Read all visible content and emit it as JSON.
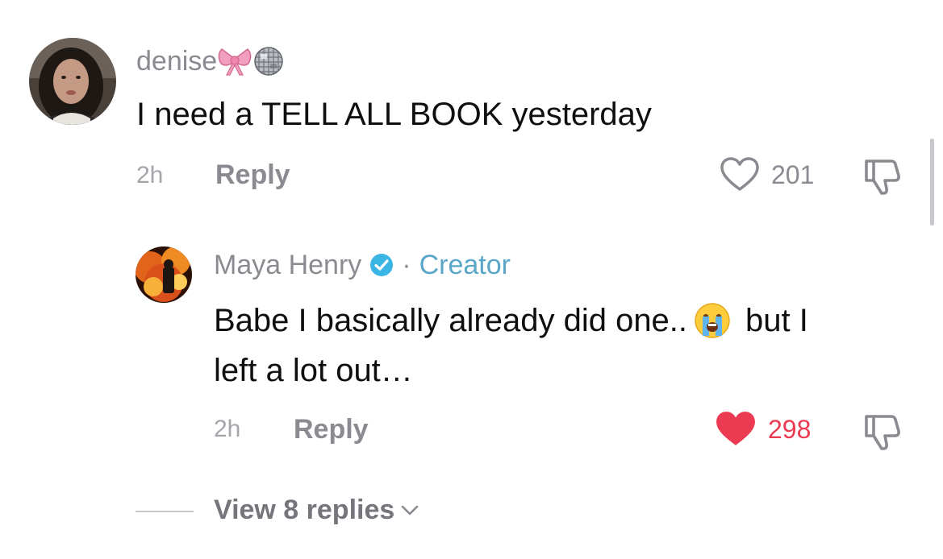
{
  "comment": {
    "username": "denise",
    "text": "I need a TELL ALL BOOK yesterday",
    "time": "2h",
    "reply_label": "Reply",
    "like_count": "201",
    "liked": false
  },
  "reply": {
    "username": "Maya Henry",
    "separator": "·",
    "creator_label": "Creator",
    "text_line1": "Babe I basically already did one..",
    "text_line1_end": "but I",
    "text_line2": "left a lot out…",
    "time": "2h",
    "reply_label": "Reply",
    "like_count": "298",
    "liked": true
  },
  "view_replies": {
    "label": "View 8 replies"
  },
  "colors": {
    "like_red": "#ec3a52",
    "creator_blue": "#5aa6c9",
    "verified_blue": "#3bb6e4",
    "muted_text": "#8a8b91"
  },
  "icons": [
    "bow-emoji",
    "disco-ball-emoji",
    "verified-badge-icon",
    "crying-face-emoji",
    "heart-outline-icon",
    "heart-filled-icon",
    "dislike-icon",
    "chevron-down-icon"
  ]
}
